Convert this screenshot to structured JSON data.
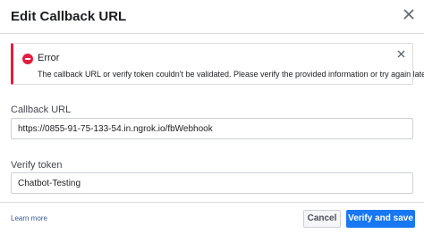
{
  "dialog": {
    "title": "Edit Callback URL"
  },
  "error": {
    "title": "Error",
    "message": "The callback URL or verify token couldn't be validated. Please verify the provided information or try again later."
  },
  "fields": {
    "callback_url": {
      "label": "Callback URL",
      "value": "https://0855-91-75-133-54.in.ngrok.io/fbWebhook"
    },
    "verify_token": {
      "label": "Verify token",
      "value": "Chatbot-Testing"
    }
  },
  "footer": {
    "learn_more": "Learn more",
    "cancel_label": "Cancel",
    "save_label": "Verify and save"
  },
  "colors": {
    "accent": "#1877f2",
    "error": "#e41e3f",
    "link": "#385898"
  },
  "icons": {
    "dialog_close": "close-icon",
    "error_indicator": "error-minus-circle-icon",
    "error_dismiss": "close-icon"
  }
}
